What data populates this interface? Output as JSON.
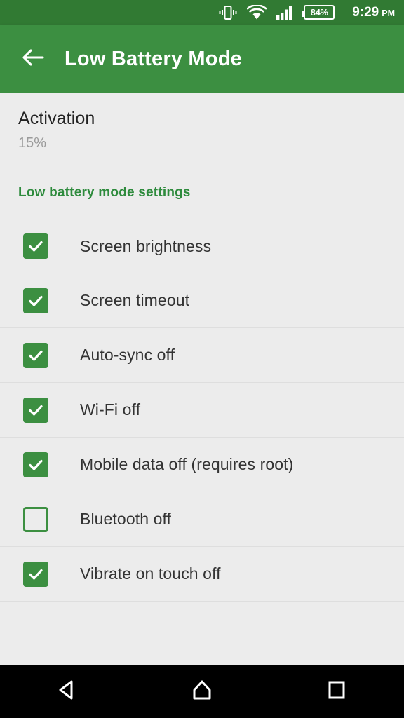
{
  "statusbar": {
    "icons": [
      "vibrate-icon",
      "wifi-icon",
      "cellular-signal-icon"
    ],
    "battery_level": "84%",
    "time": "9:29",
    "ampm": "PM"
  },
  "appbar": {
    "back_icon": "back-arrow-icon",
    "title": "Low Battery Mode",
    "background": "#3C8F41"
  },
  "activation": {
    "title": "Activation",
    "value": "15%"
  },
  "section": {
    "header": "Low battery mode settings",
    "header_color": "#2E8B3D"
  },
  "settings": [
    {
      "label": "Screen brightness",
      "checked": true
    },
    {
      "label": "Screen timeout",
      "checked": true
    },
    {
      "label": "Auto-sync off",
      "checked": true
    },
    {
      "label": "Wi-Fi off",
      "checked": true
    },
    {
      "label": "Mobile data off (requires root)",
      "checked": true
    },
    {
      "label": "Bluetooth off",
      "checked": false
    },
    {
      "label": "Vibrate on touch off",
      "checked": true
    }
  ],
  "navbar": {
    "back_label": "back-nav-icon",
    "home_label": "home-nav-icon",
    "recents_label": "recents-nav-icon"
  }
}
